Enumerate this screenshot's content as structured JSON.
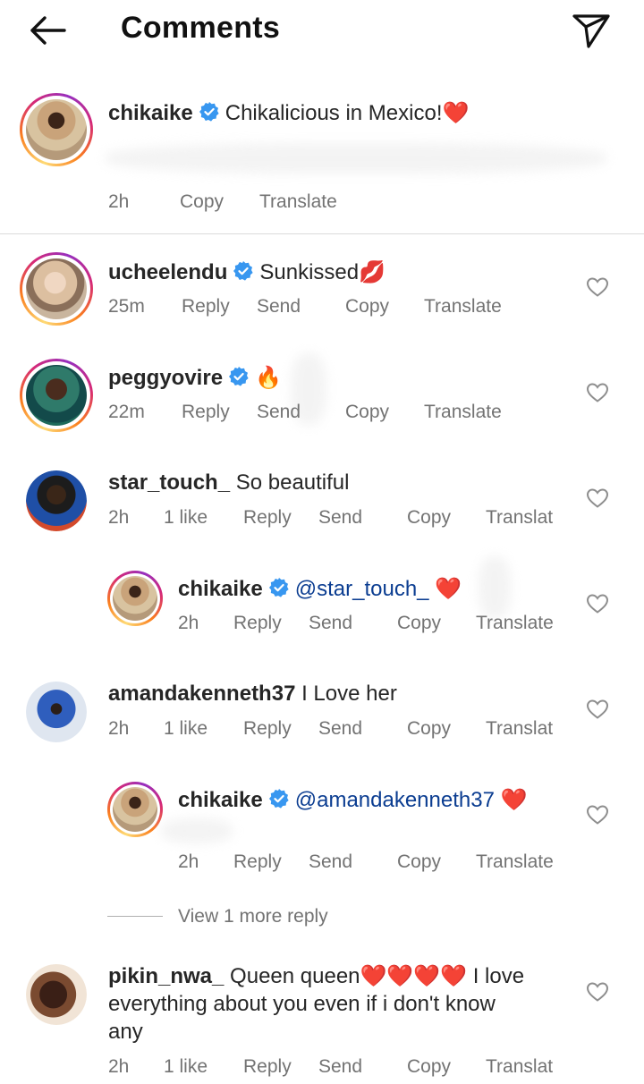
{
  "header": {
    "title": "Comments"
  },
  "caption": {
    "username": "chikaike",
    "text": "Chikalicious in Mexico!",
    "emoji": "❤️",
    "meta": {
      "time": "2h",
      "copy": "Copy",
      "translate": "Translate"
    }
  },
  "comments": [
    {
      "username": "ucheelendu",
      "text": "Sunkissed",
      "emoji": "💋",
      "time": "25m",
      "reply": "Reply",
      "send": "Send",
      "copy": "Copy",
      "translate": "Translate"
    },
    {
      "username": "peggyovire",
      "text": "",
      "emoji": "🔥",
      "time": "22m",
      "reply": "Reply",
      "send": "Send",
      "copy": "Copy",
      "translate": "Translate"
    },
    {
      "username": "star_touch_",
      "text": "So beautiful",
      "time": "2h",
      "likes": "1 like",
      "reply": "Reply",
      "send": "Send",
      "copy": "Copy",
      "translate": "Translat"
    },
    {
      "username": "chikaike",
      "mention": "@star_touch_",
      "emoji": "❤️",
      "time": "2h",
      "reply": "Reply",
      "send": "Send",
      "copy": "Copy",
      "translate": "Translate"
    },
    {
      "username": "amandakenneth37",
      "text": "I Love her",
      "time": "2h",
      "likes": "1 like",
      "reply": "Reply",
      "send": "Send",
      "copy": "Copy",
      "translate": "Translat"
    },
    {
      "username": "chikaike",
      "mention": "@amandakenneth37",
      "emoji": "❤️",
      "time": "2h",
      "reply": "Reply",
      "send": "Send",
      "copy": "Copy",
      "translate": "Translate"
    },
    {
      "username": "pikin_nwa_",
      "text_line1": "Queen queen❤️❤️❤️❤️ I love",
      "text_line2": "everything about you even if i don't know",
      "text_line3": "any",
      "time": "2h",
      "likes": "1 like",
      "reply": "Reply",
      "send": "Send",
      "copy": "Copy",
      "translate": "Translat"
    }
  ],
  "view_more": "View 1 more reply",
  "colors": {
    "verified": "#3897f0",
    "heart_red": "#ed4956",
    "mention": "#0b3d91",
    "meta_gray": "#737373"
  }
}
